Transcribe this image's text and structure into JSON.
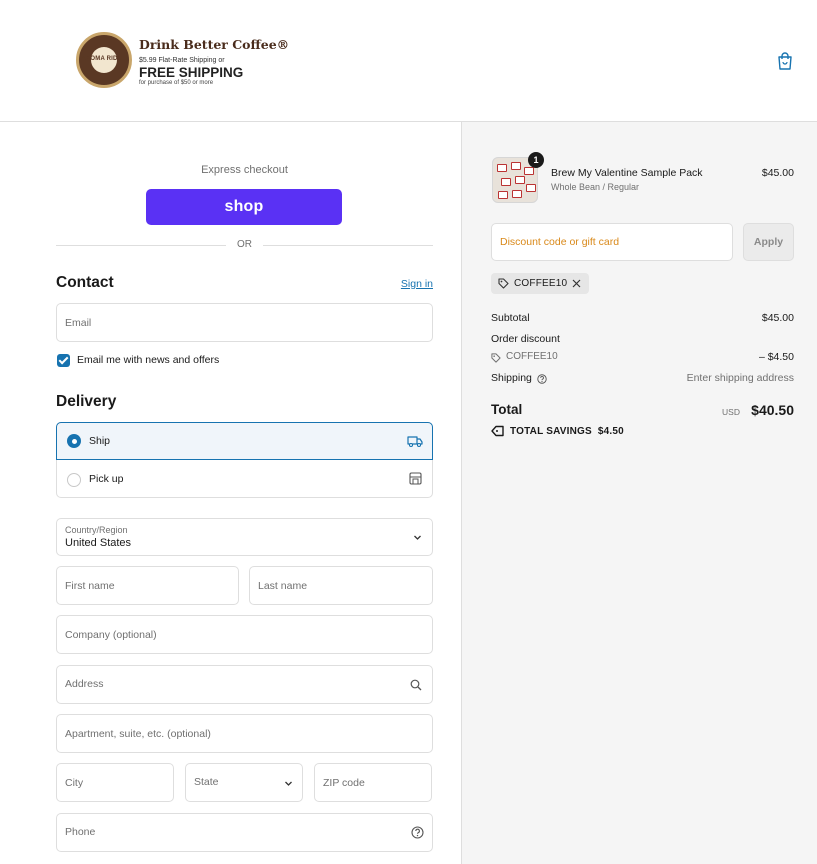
{
  "header": {
    "logo": {
      "seal_text": "AROMA RIDGE",
      "title": "Drink Better Coffee®",
      "shipping_line": "$5.99 Flat-Rate Shipping or",
      "free_shipping": "FREE SHIPPING",
      "min_purchase": "for purchase of $50 or more"
    },
    "cart_icon": "shopping-bag-icon"
  },
  "checkout": {
    "express_label": "Express checkout",
    "shop_pay_label": "shop",
    "or_label": "OR",
    "contact": {
      "heading": "Contact",
      "sign_in": "Sign in",
      "email_placeholder": "Email",
      "newsletter_label": "Email me with news and offers",
      "newsletter_checked": true
    },
    "delivery": {
      "heading": "Delivery",
      "options": [
        {
          "label": "Ship",
          "selected": true,
          "icon": "truck-icon"
        },
        {
          "label": "Pick up",
          "selected": false,
          "icon": "store-icon"
        }
      ],
      "country_label": "Country/Region",
      "country_value": "United States",
      "first_name": "First name",
      "last_name": "Last name",
      "company": "Company (optional)",
      "address": "Address",
      "apartment": "Apartment, suite, etc. (optional)",
      "city": "City",
      "state": "State",
      "zip": "ZIP code",
      "phone": "Phone"
    }
  },
  "summary": {
    "item": {
      "name": "Brew My Valentine Sample Pack",
      "variant": "Whole Bean / Regular",
      "price": "$45.00",
      "quantity": "1"
    },
    "discount_placeholder": "Discount code or gift card",
    "apply_label": "Apply",
    "applied_code": "COFFEE10",
    "subtotal_label": "Subtotal",
    "subtotal_value": "$45.00",
    "order_discount_label": "Order discount",
    "discount_code": "COFFEE10",
    "discount_value": "– $4.50",
    "shipping_label": "Shipping",
    "shipping_value": "Enter shipping address",
    "total_label": "Total",
    "currency": "USD",
    "total_value": "$40.50",
    "savings_label": "TOTAL SAVINGS",
    "savings_value": "$4.50"
  }
}
